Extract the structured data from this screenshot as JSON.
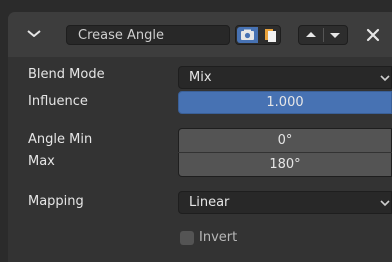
{
  "header": {
    "modifier_name": "Crease Angle",
    "icons": [
      "collapse-chevron-icon",
      "render-camera-icon",
      "copy-icon",
      "move-up-icon",
      "move-down-icon",
      "close-icon"
    ],
    "toggle_active_color": "#4772b3"
  },
  "fields": {
    "blend_mode": {
      "label": "Blend Mode",
      "value": "Mix"
    },
    "influence": {
      "label": "Influence",
      "value": "1.000",
      "fill_fraction": 1.0
    },
    "angle_min": {
      "label": "Angle Min",
      "value": "0°"
    },
    "max": {
      "label": "Max",
      "value": "180°"
    },
    "mapping": {
      "label": "Mapping",
      "value": "Linear"
    },
    "invert": {
      "label": "Invert",
      "checked": false
    }
  },
  "colors": {
    "panel": "#333333",
    "header": "#3d3d3d",
    "accent": "#4772b3"
  }
}
